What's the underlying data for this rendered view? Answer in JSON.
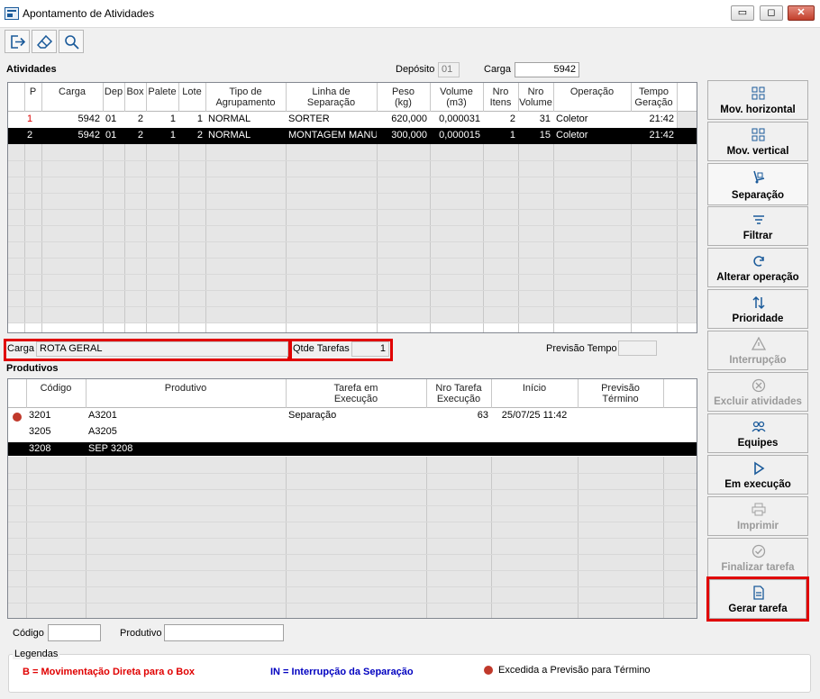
{
  "window": {
    "title": "Apontamento de Atividades",
    "minimize": "▭",
    "maximize": "◻",
    "close": "✕"
  },
  "toolbar": {
    "exit_icon": "exit-icon",
    "clear_icon": "eraser-icon",
    "search_icon": "search-icon"
  },
  "atividades": {
    "label": "Atividades",
    "deposito_label": "Depósito",
    "deposito_value": "01",
    "carga_label": "Carga",
    "carga_value": "5942",
    "headers": [
      "P",
      "Carga",
      "Dep",
      "Box",
      "Palete",
      "Lote",
      "Tipo de\nAgrupamento",
      "Linha de\nSeparação",
      "Peso\n(kg)",
      "Volume\n(m3)",
      "Nro\nItens",
      "Nro\nVolume",
      "Operação",
      "Tempo\nGeração"
    ],
    "rows": [
      {
        "p": "1",
        "carga": "5942",
        "dep": "01",
        "box": "2",
        "palete": "1",
        "lote": "1",
        "tipo": "NORMAL",
        "linha": "SORTER",
        "peso": "620,000",
        "volume": "0,000031",
        "itens": "2",
        "nvol": "31",
        "op": "Coletor",
        "tempo": "21:42"
      },
      {
        "p": "2",
        "carga": "5942",
        "dep": "01",
        "box": "2",
        "palete": "1",
        "lote": "2",
        "tipo": "NORMAL",
        "linha": "MONTAGEM MANU",
        "peso": "300,000",
        "volume": "0,000015",
        "itens": "1",
        "nvol": "15",
        "op": "Coletor",
        "tempo": "21:42"
      }
    ]
  },
  "mid": {
    "carga_label": "Carga",
    "carga_value": "ROTA GERAL",
    "qtde_label": "Qtde Tarefas",
    "qtde_value": "1",
    "previsao_label": "Previsão Tempo",
    "previsao_value": ""
  },
  "produtivos": {
    "label": "Produtivos",
    "headers": [
      "Código",
      "Produtivo",
      "Tarefa em\nExecução",
      "Nro Tarefa\nExecução",
      "Início",
      "Previsão\nTérmino"
    ],
    "rows": [
      {
        "codigo": "3201",
        "produtivo": "A3201",
        "tarefa": "Separação",
        "nro": "63",
        "inicio": "25/07/25 11:42",
        "previsao": "",
        "exceeded": true
      },
      {
        "codigo": "3205",
        "produtivo": "A3205",
        "tarefa": "",
        "nro": "",
        "inicio": "",
        "previsao": "",
        "exceeded": false
      },
      {
        "codigo": "3208",
        "produtivo": "SEP 3208",
        "tarefa": "",
        "nro": "",
        "inicio": "",
        "previsao": "",
        "exceeded": false
      }
    ]
  },
  "filters": {
    "codigo_label": "Código",
    "codigo_value": "",
    "produtivo_label": "Produtivo",
    "produtivo_value": ""
  },
  "legend": {
    "title": "Legendas",
    "item1": "B = Movimentação Direta para o Box",
    "item2": "IN = Interrupção da Separação",
    "item3": "Excedida a Previsão para Término",
    "colors": {
      "item1": "#e00000",
      "item2": "#0000c0",
      "dot": "#c0392b"
    }
  },
  "side_buttons": [
    {
      "label": "Mov. horizontal",
      "icon": "grid-icon",
      "enabled": true
    },
    {
      "label": "Mov. vertical",
      "icon": "grid-icon",
      "enabled": true
    },
    {
      "label": "Separação",
      "icon": "hand-truck-icon",
      "enabled": true
    },
    {
      "label": "Filtrar",
      "icon": "filter-icon",
      "enabled": true
    },
    {
      "label": "Alterar operação",
      "icon": "refresh-icon",
      "enabled": true
    },
    {
      "label": "Prioridade",
      "icon": "sort-arrows-icon",
      "enabled": true
    },
    {
      "label": "Interrupção",
      "icon": "warning-icon",
      "enabled": false
    },
    {
      "label": "Excluir atividades",
      "icon": "cancel-icon",
      "enabled": false
    },
    {
      "label": "Equipes",
      "icon": "team-icon",
      "enabled": true
    },
    {
      "label": "Em execução",
      "icon": "play-icon",
      "enabled": true
    },
    {
      "label": "Imprimir",
      "icon": "printer-icon",
      "enabled": false
    },
    {
      "label": "Finalizar tarefa",
      "icon": "check-circle-icon",
      "enabled": false
    },
    {
      "label": "Gerar tarefa",
      "icon": "document-icon",
      "enabled": true
    }
  ]
}
